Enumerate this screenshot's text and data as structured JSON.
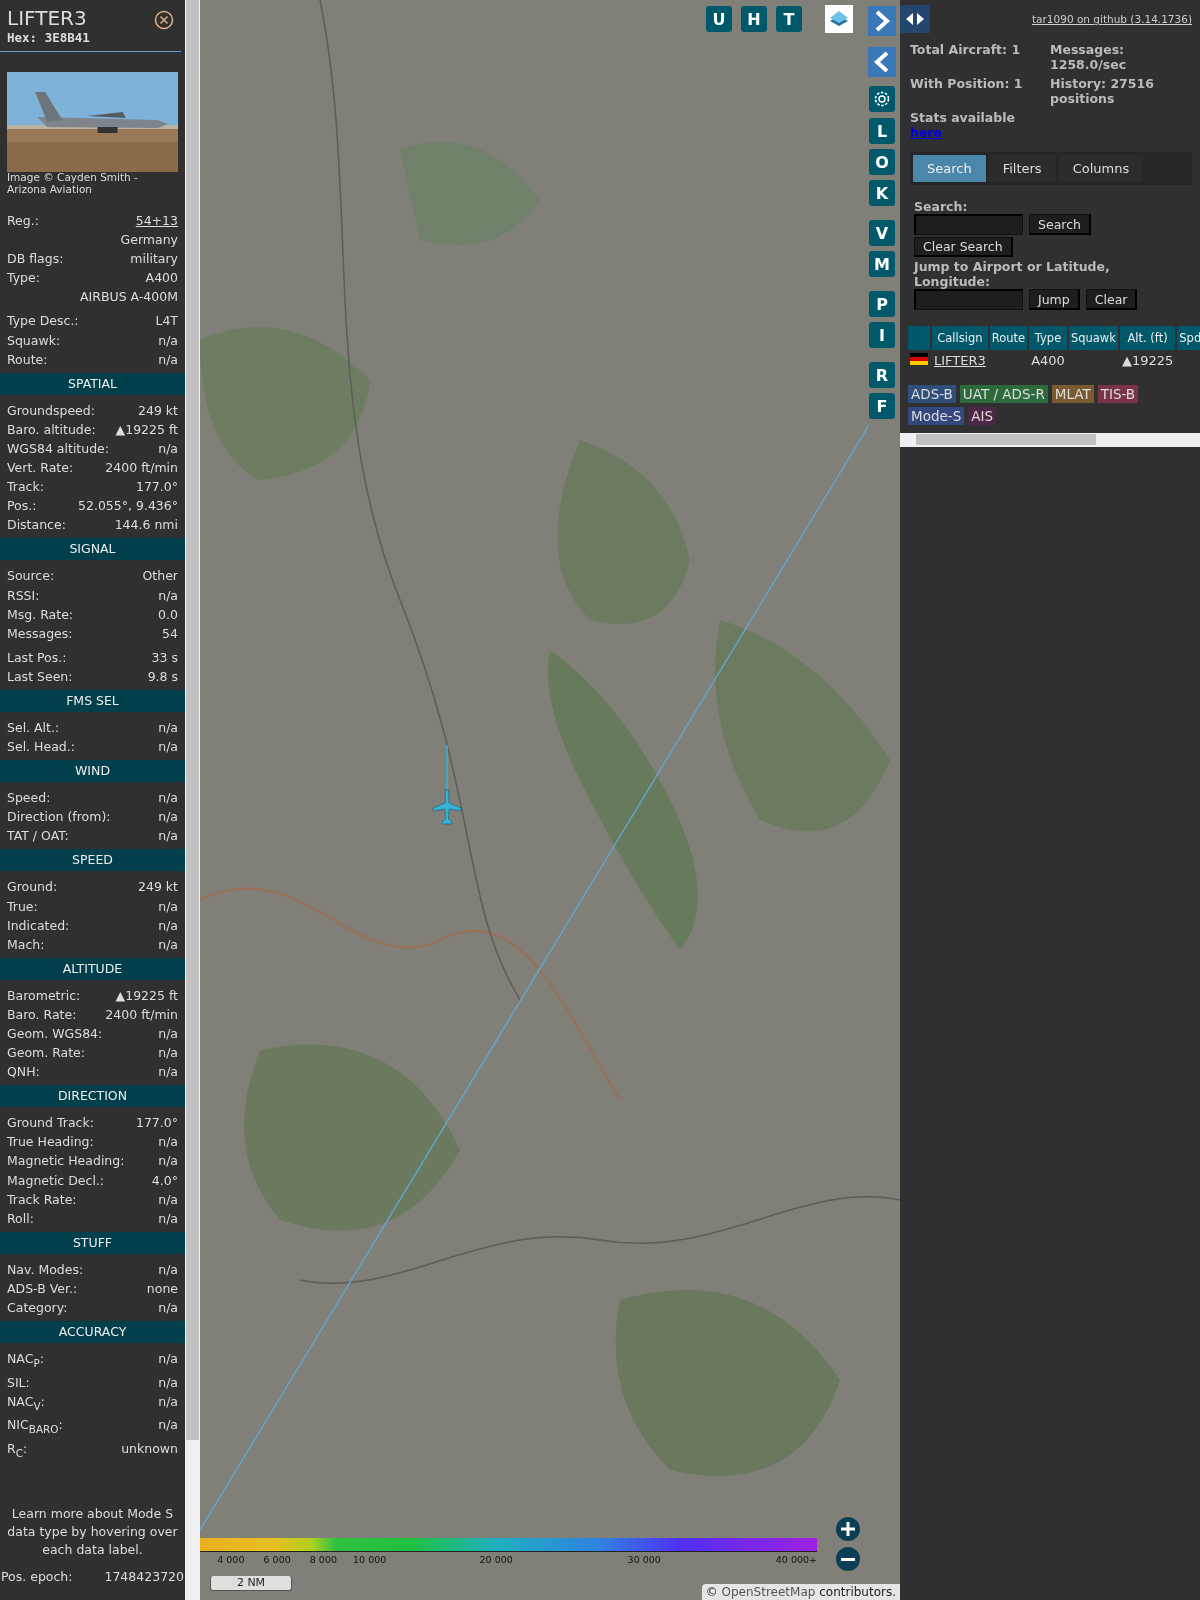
{
  "sidebar": {
    "title": "LIFTER3",
    "hex": "Hex: 3E8B41",
    "photo_credit": "Image © Cayden Smith - Arizona Aviation",
    "info_groups": [
      [
        {
          "label": "Reg.:",
          "value": "54+13",
          "kind": "link"
        },
        {
          "value": "Germany",
          "kind": "text"
        },
        {
          "label": "DB flags:",
          "value": "military",
          "kind": "text"
        },
        {
          "label": "Type:",
          "value": "A400",
          "kind": "text"
        },
        {
          "value": "AIRBUS A-400M",
          "kind": "text"
        }
      ],
      [
        {
          "label": "Type Desc.:",
          "value": "L4T",
          "kind": "text"
        },
        {
          "label": "Squawk:",
          "value": "n/a",
          "kind": "text"
        },
        {
          "label": "Route:",
          "value": "n/a",
          "kind": "text"
        }
      ]
    ],
    "sections": [
      {
        "title": "SPATIAL",
        "groups": [
          [
            {
              "label": "Groundspeed:",
              "value": "249 kt"
            },
            {
              "label": "Baro. altitude:",
              "value": "▲19225 ft"
            },
            {
              "label": "WGS84 altitude:",
              "value": "n/a"
            },
            {
              "label": "Vert. Rate:",
              "value": "2400 ft/min"
            },
            {
              "label": "Track:",
              "value": "177.0°"
            },
            {
              "label": "Pos.:",
              "value": "52.055°, 9.436°"
            },
            {
              "label": "Distance:",
              "value": "144.6 nmi"
            }
          ]
        ]
      },
      {
        "title": "SIGNAL",
        "groups": [
          [
            {
              "label": "Source:",
              "value": "Other"
            },
            {
              "label": "RSSI:",
              "value": "n/a"
            },
            {
              "label": "Msg. Rate:",
              "value": "0.0"
            },
            {
              "label": "Messages:",
              "value": "54"
            }
          ],
          [
            {
              "label": "Last Pos.:",
              "value": "33 s"
            },
            {
              "label": "Last Seen:",
              "value": "9.8 s"
            }
          ]
        ]
      },
      {
        "title": "FMS SEL",
        "groups": [
          [
            {
              "label": "Sel. Alt.:",
              "value": "n/a"
            },
            {
              "label": "Sel. Head.:",
              "value": "n/a"
            }
          ]
        ]
      },
      {
        "title": "WIND",
        "groups": [
          [
            {
              "label": "Speed:",
              "value": "n/a"
            },
            {
              "label": "Direction (from):",
              "value": "n/a"
            },
            {
              "label": "TAT / OAT:",
              "value": "n/a"
            }
          ]
        ]
      },
      {
        "title": "SPEED",
        "groups": [
          [
            {
              "label": "Ground:",
              "value": "249 kt"
            },
            {
              "label": "True:",
              "value": "n/a"
            },
            {
              "label": "Indicated:",
              "value": "n/a"
            },
            {
              "label": "Mach:",
              "value": "n/a"
            }
          ]
        ]
      },
      {
        "title": "ALTITUDE",
        "groups": [
          [
            {
              "label": "Barometric:",
              "value": "▲19225 ft"
            },
            {
              "label": "Baro. Rate:",
              "value": "2400 ft/min"
            },
            {
              "label": "Geom. WGS84:",
              "value": "n/a"
            },
            {
              "label": "Geom. Rate:",
              "value": "n/a"
            },
            {
              "label": "QNH:",
              "value": "n/a"
            }
          ]
        ]
      },
      {
        "title": "DIRECTION",
        "groups": [
          [
            {
              "label": "Ground Track:",
              "value": "177.0°"
            },
            {
              "label": "True Heading:",
              "value": "n/a"
            },
            {
              "label": "Magnetic Heading:",
              "value": "n/a"
            },
            {
              "label": "Magnetic Decl.:",
              "value": "4.0°"
            },
            {
              "label": "Track Rate:",
              "value": "n/a"
            },
            {
              "label": "Roll:",
              "value": "n/a"
            }
          ]
        ]
      },
      {
        "title": "STUFF",
        "groups": [
          [
            {
              "label": "Nav. Modes:",
              "value": "n/a"
            },
            {
              "label": "ADS-B Ver.:",
              "value": "none"
            },
            {
              "label": "Category:",
              "value": "n/a"
            }
          ]
        ]
      },
      {
        "title": "ACCURACY",
        "groups": [
          [
            {
              "label": "NAC$_{P}$:",
              "value": "n/a"
            },
            {
              "label": "SIL:",
              "value": "n/a"
            },
            {
              "label": "NAC$_{V}$:",
              "value": "n/a"
            },
            {
              "label": "NIC$_{BARO}$:",
              "value": "n/a"
            },
            {
              "label": "R$_{C}$:",
              "value": "unknown"
            }
          ]
        ]
      }
    ],
    "note": "Learn more about Mode S data type by hovering over each data label.",
    "epoch": {
      "label": "Pos. epoch:",
      "value": "1748423720"
    }
  },
  "map": {
    "top_buttons": [
      "U",
      "H",
      "T"
    ],
    "side_button_groups": [
      [
        "L",
        "O",
        "K"
      ],
      [
        "V",
        "M"
      ],
      [
        "P",
        "I"
      ],
      [
        "R",
        "F"
      ]
    ],
    "color_scale": [
      "4 000",
      "6 000",
      "8 000",
      "10 000",
      "20 000",
      "30 000",
      "40 000+"
    ],
    "scale": "2 NM",
    "attribution": {
      "prefix": "©",
      "link": "OpenStreetMap",
      "suffix": "contributors."
    }
  },
  "panel": {
    "version_link": "tar1090 on github (3.14.1736)",
    "stats": {
      "total": "Total Aircraft: 1",
      "with_position": "With Position: 1",
      "stats_text": "Stats available",
      "stats_link": "here",
      "messages": "Messages: 1258.0/sec",
      "history": "History: 27516 positions"
    },
    "tabs": [
      {
        "label": "Search",
        "selected": true
      },
      {
        "label": "Filters",
        "selected": false
      },
      {
        "label": "Columns",
        "selected": false
      }
    ],
    "search_label": "Search:",
    "search_button": "Search",
    "clear_search_button": "Clear Search",
    "jump_label": "Jump to Airport or Latitude, Longitude:",
    "jump_button": "Jump",
    "clear_button": "Clear",
    "table": {
      "columns": [
        "Callsign",
        "Route",
        "Type",
        "Squawk",
        "Alt. (ft)",
        "Spd"
      ],
      "rows": [
        {
          "callsign": "LIFTER3",
          "route": "",
          "type": "A400",
          "squawk": "",
          "altitude": "▲19225"
        }
      ]
    },
    "sources": [
      {
        "label": "ADS-B",
        "color": "#2f4f7a"
      },
      {
        "label": "UAT / ADS-R",
        "color": "#2d6b3c"
      },
      {
        "label": "MLAT",
        "color": "#7a5a30"
      },
      {
        "label": "TIS-B",
        "color": "#7a3448"
      },
      {
        "label": "Mode-S",
        "color": "#34477e"
      },
      {
        "label": "AIS",
        "color": "#4e2646"
      }
    ]
  }
}
